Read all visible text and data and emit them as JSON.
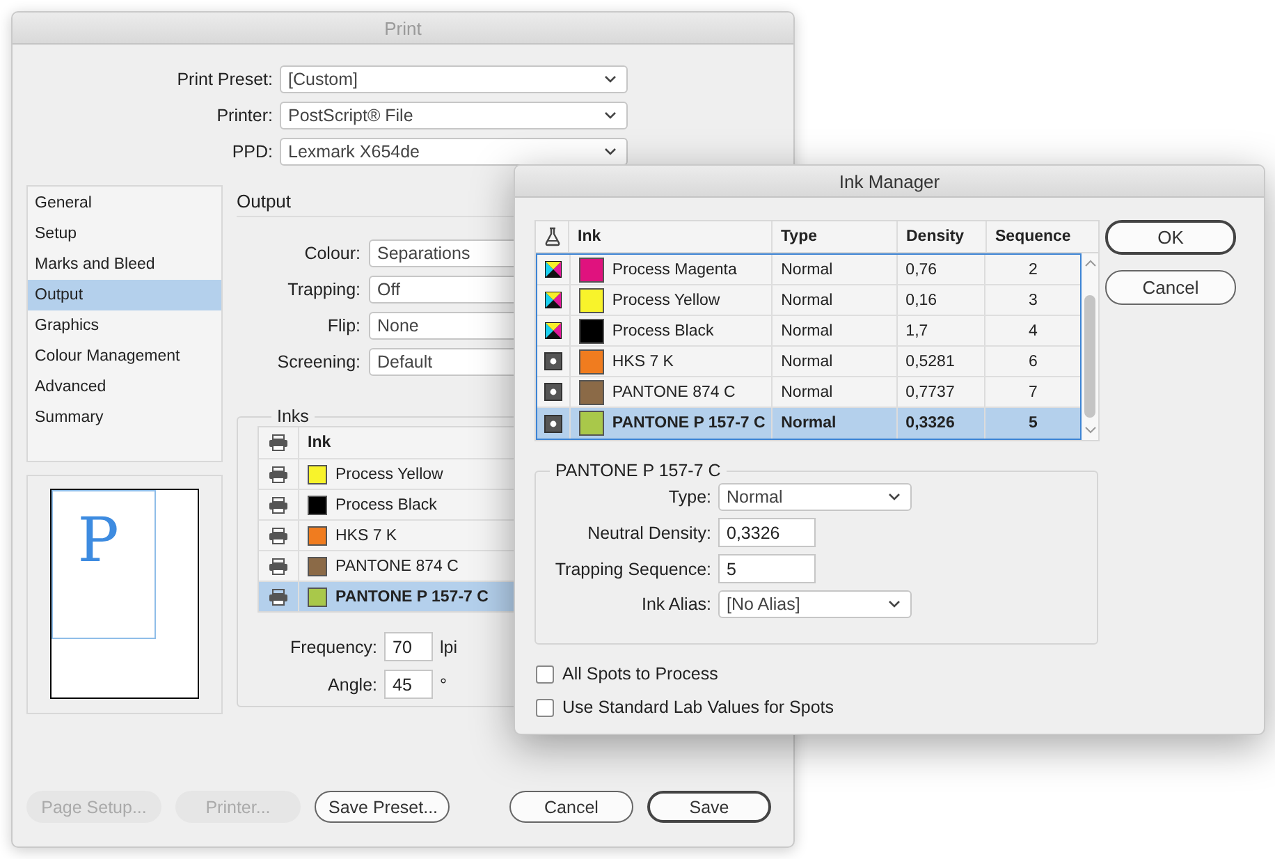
{
  "print_dialog": {
    "title": "Print",
    "preset_fields": [
      {
        "label": "Print Preset:",
        "value": "[Custom]"
      },
      {
        "label": "Printer:",
        "value": "PostScript® File"
      },
      {
        "label": "PPD:",
        "value": "Lexmark X654de"
      }
    ],
    "sidebar": {
      "items": [
        {
          "label": "General",
          "selected": false
        },
        {
          "label": "Setup",
          "selected": false
        },
        {
          "label": "Marks and Bleed",
          "selected": false
        },
        {
          "label": "Output",
          "selected": true
        },
        {
          "label": "Graphics",
          "selected": false
        },
        {
          "label": "Colour Management",
          "selected": false
        },
        {
          "label": "Advanced",
          "selected": false
        },
        {
          "label": "Summary",
          "selected": false
        }
      ]
    },
    "preview": {
      "letter": "P"
    },
    "output": {
      "heading": "Output",
      "fields": [
        {
          "label": "Colour:",
          "value": "Separations"
        },
        {
          "label": "Trapping:",
          "value": "Off"
        },
        {
          "label": "Flip:",
          "value": "None"
        },
        {
          "label": "Screening:",
          "value": "Default"
        }
      ]
    },
    "inks": {
      "legend": "Inks",
      "column": "Ink",
      "rows": [
        {
          "name": "Process Yellow",
          "color": "#f8f32b",
          "selected": false
        },
        {
          "name": "Process Black",
          "color": "#000000",
          "selected": false
        },
        {
          "name": "HKS 7 K",
          "color": "#f07c1f",
          "selected": false
        },
        {
          "name": "PANTONE 874 C",
          "color": "#8b6a47",
          "selected": false
        },
        {
          "name": "PANTONE P 157-7 C",
          "color": "#a9c84a",
          "selected": true
        }
      ],
      "frequency": {
        "label": "Frequency:",
        "value": "70",
        "unit": "lpi"
      },
      "angle": {
        "label": "Angle:",
        "value": "45",
        "unit": "°"
      }
    },
    "buttons": [
      {
        "label": "Page Setup...",
        "disabled": true,
        "default": false
      },
      {
        "label": "Printer...",
        "disabled": true,
        "default": false
      },
      {
        "label": "Save Preset...",
        "disabled": false,
        "default": false
      },
      {
        "label": "Cancel",
        "disabled": false,
        "default": false
      },
      {
        "label": "Save",
        "disabled": false,
        "default": true
      }
    ]
  },
  "ink_manager": {
    "title": "Ink Manager",
    "columns": [
      "Ink",
      "Type",
      "Density",
      "Sequence"
    ],
    "rows": [
      {
        "kind": "process",
        "name": "Process Magenta",
        "color": "#e0127e",
        "type": "Normal",
        "density": "0,76",
        "sequence": "2",
        "selected": false
      },
      {
        "kind": "process",
        "name": "Process Yellow",
        "color": "#f8f32b",
        "type": "Normal",
        "density": "0,16",
        "sequence": "3",
        "selected": false
      },
      {
        "kind": "process",
        "name": "Process Black",
        "color": "#000000",
        "type": "Normal",
        "density": "1,7",
        "sequence": "4",
        "selected": false
      },
      {
        "kind": "spot",
        "name": "HKS 7 K",
        "color": "#f07c1f",
        "type": "Normal",
        "density": "0,5281",
        "sequence": "6",
        "selected": false
      },
      {
        "kind": "spot",
        "name": "PANTONE 874 C",
        "color": "#8b6a47",
        "type": "Normal",
        "density": "0,7737",
        "sequence": "7",
        "selected": false
      },
      {
        "kind": "spot",
        "name": "PANTONE P 157-7 C",
        "color": "#a9c84a",
        "type": "Normal",
        "density": "0,3326",
        "sequence": "5",
        "selected": true
      }
    ],
    "buttons": [
      {
        "label": "OK",
        "default": true
      },
      {
        "label": "Cancel",
        "default": false
      }
    ],
    "detail": {
      "legend": "PANTONE P 157-7 C",
      "fields": [
        {
          "kind": "select",
          "label": "Type:",
          "value": "Normal"
        },
        {
          "kind": "input",
          "label": "Neutral Density:",
          "value": "0,3326"
        },
        {
          "kind": "input",
          "label": "Trapping Sequence:",
          "value": "5"
        },
        {
          "kind": "select",
          "label": "Ink Alias:",
          "value": "[No Alias]"
        }
      ]
    },
    "checkboxes": [
      {
        "label": "All Spots to Process",
        "checked": false
      },
      {
        "label": "Use Standard Lab Values for Spots",
        "checked": false
      }
    ]
  }
}
